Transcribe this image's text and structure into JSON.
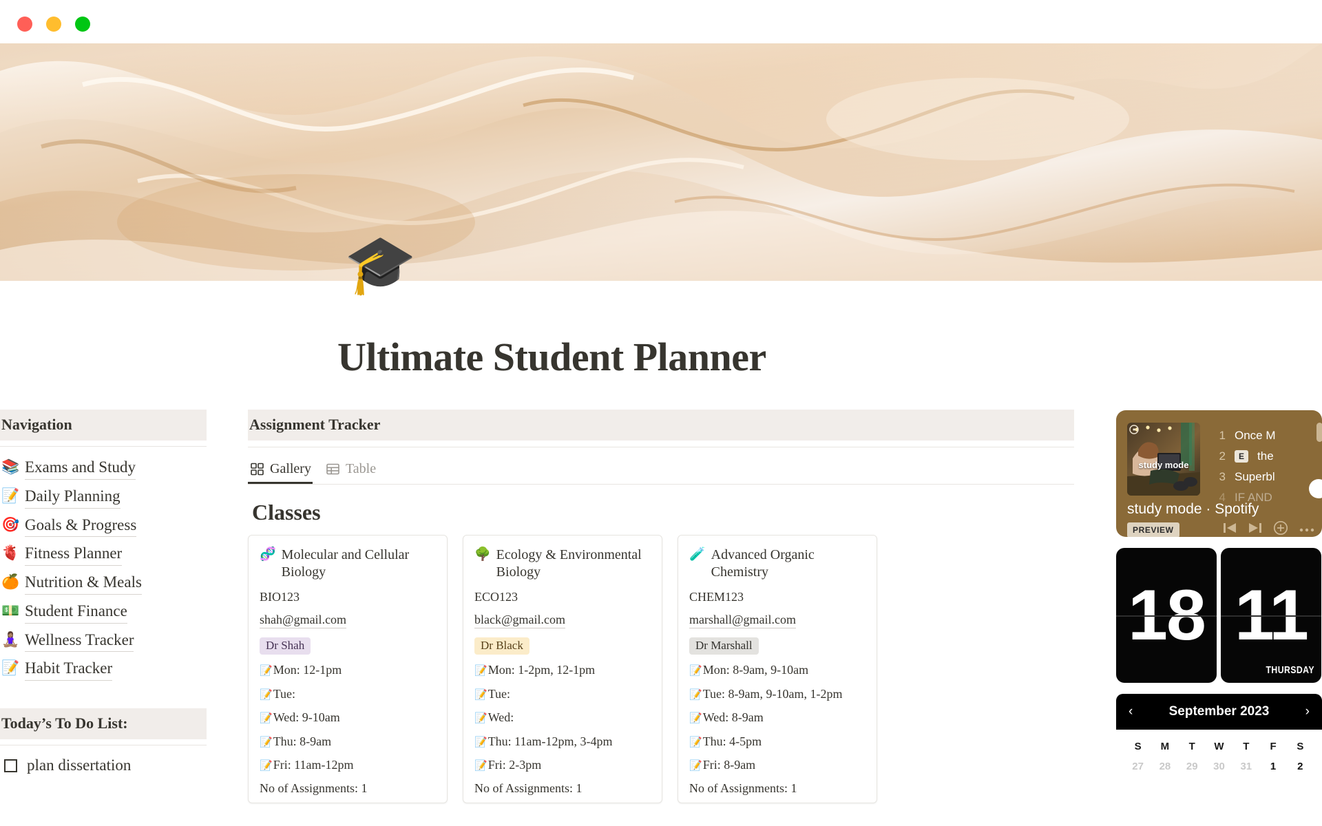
{
  "window": {
    "lights": [
      "close-red",
      "minimize-yellow",
      "maximize-green"
    ]
  },
  "page": {
    "icon": "🎓",
    "icon_name": "woman-student-emoji",
    "title": "Ultimate Student Planner"
  },
  "sidebar": {
    "nav_header": "Navigation",
    "items": [
      {
        "emoji": "📚",
        "icon_name": "books-emoji",
        "label": "Exams and Study"
      },
      {
        "emoji": "📝",
        "icon_name": "memo-emoji",
        "label": "Daily Planning"
      },
      {
        "emoji": "🎯",
        "icon_name": "target-emoji",
        "label": "Goals & Progress"
      },
      {
        "emoji": "🫀",
        "icon_name": "heart-emoji",
        "label": "Fitness Planner"
      },
      {
        "emoji": "🍊",
        "icon_name": "tangerine-emoji",
        "label": "Nutrition & Meals"
      },
      {
        "emoji": "💵",
        "icon_name": "banknote-emoji",
        "label": "Student Finance"
      },
      {
        "emoji": "🧘🏽‍♀️",
        "icon_name": "lotus-emoji",
        "label": "Wellness Tracker"
      },
      {
        "emoji": "📝",
        "icon_name": "memo-emoji",
        "label": "Habit Tracker"
      }
    ],
    "todo_header": "Today’s To Do List:",
    "todos": [
      {
        "label": "plan dissertation",
        "checked": false
      }
    ]
  },
  "main": {
    "section_header": "Assignment Tracker",
    "tabs": [
      {
        "label": "Gallery",
        "icon": "gallery-icon",
        "active": true
      },
      {
        "label": "Table",
        "icon": "table-icon",
        "active": false
      }
    ],
    "classes_heading": "Classes",
    "cards": [
      {
        "emoji": "🧬",
        "icon_name": "dna-emoji",
        "title": "Molecular and Cellular Biology",
        "code": "BIO123",
        "email": "shah@gmail.com",
        "teacher": "Dr Shah",
        "teacher_tag_color": "#e8deee",
        "schedule": [
          "Mon: 12-1pm",
          "Tue:",
          "Wed: 9-10am",
          "Thu: 8-9am",
          "Fri: 11am-12pm"
        ],
        "assignments_label": "No of Assignments: 1"
      },
      {
        "emoji": "🌳",
        "icon_name": "tree-emoji",
        "title": "Ecology & Environmental Biology",
        "code": "ECO123",
        "email": "black@gmail.com",
        "teacher": "Dr Black",
        "teacher_tag_color": "#fbecc9",
        "schedule": [
          "Mon: 1-2pm, 12-1pm",
          "Tue:",
          "Wed:",
          "Thu: 11am-12pm, 3-4pm",
          "Fri: 2-3pm"
        ],
        "assignments_label": "No of Assignments: 1"
      },
      {
        "emoji": "🧪",
        "icon_name": "test-tube-emoji",
        "title": "Advanced Organic Chemistry",
        "code": "CHEM123",
        "email": "marshall@gmail.com",
        "teacher": "Dr Marshall",
        "teacher_tag_color": "#e3e2df",
        "schedule": [
          "Mon: 8-9am, 9-10am",
          "Tue: 8-9am, 9-10am, 1-2pm",
          "Wed: 8-9am",
          "Thu: 4-5pm",
          "Fri: 8-9am"
        ],
        "assignments_label": "No of Assignments: 1"
      }
    ],
    "schedule_emoji": "📝"
  },
  "rail": {
    "spotify": {
      "art_label": "study mode",
      "meta": "study mode · Spotify",
      "preview_label": "PREVIEW",
      "tracks": [
        {
          "num": "1",
          "title": "Once M",
          "explicit": false
        },
        {
          "num": "2",
          "title": "the",
          "explicit": true,
          "explicit_badge": "E"
        },
        {
          "num": "3",
          "title": "Superbl",
          "explicit": false
        },
        {
          "num": "4",
          "title": "IF AND",
          "explicit": false
        }
      ],
      "controls": [
        "previous-track",
        "next-track",
        "add",
        "more-options"
      ]
    },
    "flip_clock": {
      "day_number": "18",
      "hour_number": "11",
      "day_of_week": "THURSDAY"
    },
    "calendar": {
      "month_label": "September 2023",
      "prev_label": "‹",
      "next_label": "›",
      "day_headers": [
        "S",
        "M",
        "T",
        "W",
        "T",
        "F",
        "S"
      ],
      "first_week": [
        {
          "d": "27",
          "muted": true
        },
        {
          "d": "28",
          "muted": true
        },
        {
          "d": "29",
          "muted": true
        },
        {
          "d": "30",
          "muted": true
        },
        {
          "d": "31",
          "muted": true
        },
        {
          "d": "1",
          "muted": false
        },
        {
          "d": "2",
          "muted": false
        }
      ]
    }
  },
  "colors": {
    "header_band": "#f1edea",
    "text": "#37352f",
    "banner_tan": "#c89560",
    "spotify_bg": "#8a6a38",
    "accent_black": "#060606"
  }
}
